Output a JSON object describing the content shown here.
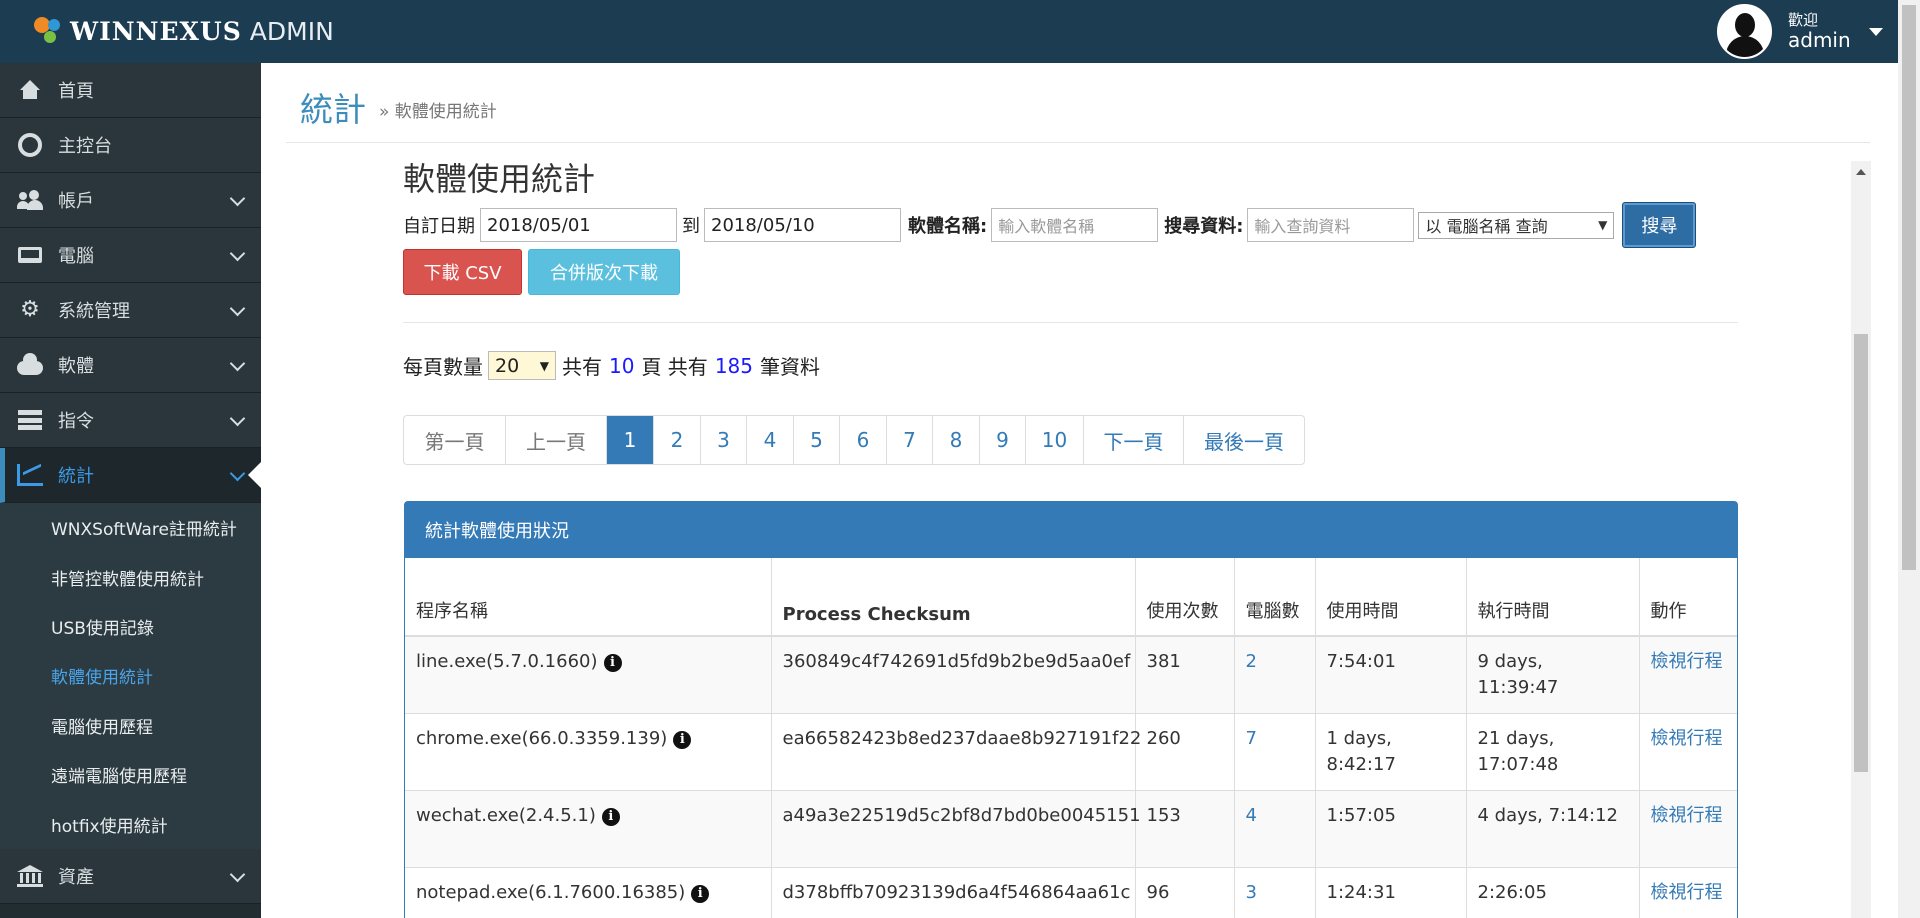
{
  "app": {
    "brand": "WINNEXUS",
    "brand_suffix": "ADMIN",
    "welcome": "歡迎",
    "username": "admin"
  },
  "sidebar": {
    "items": [
      {
        "label": "首頁",
        "icon": "home-icon"
      },
      {
        "label": "主控台",
        "icon": "dashboard-icon"
      },
      {
        "label": "帳戶",
        "icon": "users-icon"
      },
      {
        "label": "電腦",
        "icon": "laptop-icon"
      },
      {
        "label": "系統管理",
        "icon": "cogs-icon"
      },
      {
        "label": "軟體",
        "icon": "cloud-icon"
      },
      {
        "label": "指令",
        "icon": "server-icon"
      },
      {
        "label": "統計",
        "icon": "line-chart-icon"
      },
      {
        "label": "資產",
        "icon": "bank-icon"
      }
    ],
    "submenu": [
      "WNXSoftWare註冊統計",
      "非管控軟體使用統計",
      "USB使用記錄",
      "軟體使用統計",
      "電腦使用歷程",
      "遠端電腦使用歷程",
      "hotfix使用統計"
    ],
    "active_item": "統計",
    "active_sub": "軟體使用統計"
  },
  "header": {
    "title": "統計",
    "breadcrumb": "» 軟體使用統計"
  },
  "panel": {
    "title": "軟體使用統計"
  },
  "filters": {
    "date_label": "自訂日期",
    "date_from": "2018/05/01",
    "to_label": "到",
    "date_to": "2018/05/10",
    "software_label": "軟體名稱:",
    "software_placeholder": "輸入軟體名稱",
    "search_label": "搜尋資料:",
    "search_placeholder": "輸入查詢資料",
    "search_by": "以 電腦名稱 查詢",
    "search_button": "搜尋",
    "csv_button": "下載 CSV",
    "merge_button": "合併版次下載"
  },
  "paging_info": {
    "per_page_label": "每頁數量",
    "per_page": "20",
    "total_label_1": "共有",
    "total_pages": "10",
    "total_label_2": "頁 共有",
    "total_records": "185",
    "total_label_3": "筆資料"
  },
  "pagination": {
    "first": "第一頁",
    "prev": "上一頁",
    "pages": [
      "1",
      "2",
      "3",
      "4",
      "5",
      "6",
      "7",
      "8",
      "9",
      "10"
    ],
    "current": "1",
    "next": "下一頁",
    "last": "最後一頁"
  },
  "table": {
    "title": "統計軟體使用狀況",
    "columns": [
      "程序名稱",
      "Process Checksum",
      "使用次數",
      "電腦數",
      "使用時間",
      "執行時間",
      "動作"
    ],
    "rows": [
      {
        "process": "line.exe(5.7.0.1660)",
        "checksum": "360849c4f742691d5fd9b2be9d5aa0ef",
        "uses": "381",
        "computers": "2",
        "use_time": "7:54:01",
        "run_time": "9 days, 11:39:47",
        "action": "檢視行程"
      },
      {
        "process": "chrome.exe(66.0.3359.139)",
        "checksum": "ea66582423b8ed237daae8b927191f22",
        "uses": "260",
        "computers": "7",
        "use_time": "1 days, 8:42:17",
        "run_time": "21 days, 17:07:48",
        "action": "檢視行程"
      },
      {
        "process": "wechat.exe(2.4.5.1)",
        "checksum": "a49a3e22519d5c2bf8d7bd0be0045151",
        "uses": "153",
        "computers": "4",
        "use_time": "1:57:05",
        "run_time": "4 days, 7:14:12",
        "action": "檢視行程"
      },
      {
        "process": "notepad.exe(6.1.7600.16385)",
        "checksum": "d378bffb70923139d6a4f546864aa61c",
        "uses": "96",
        "computers": "3",
        "use_time": "1:24:31",
        "run_time": "2:26:05",
        "action": "檢視行程"
      }
    ]
  },
  "colors": {
    "topbar": "#1c3c52",
    "sidebar": "#222d32",
    "accent": "#337ab7",
    "danger": "#d9534f",
    "info": "#5bc0de"
  }
}
